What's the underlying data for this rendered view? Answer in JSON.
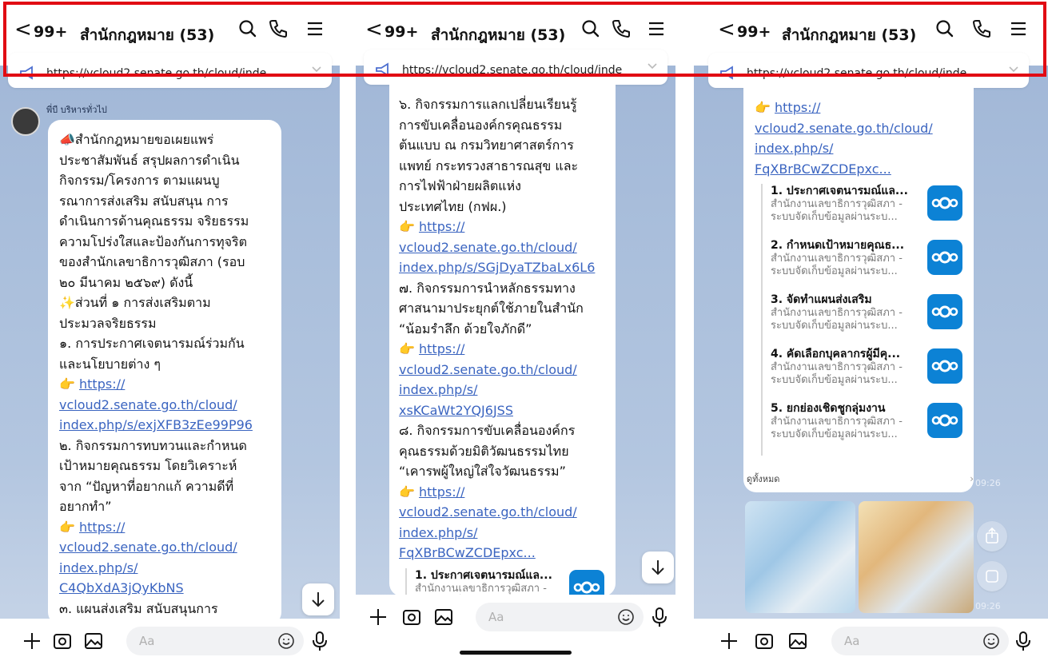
{
  "header": {
    "back_glyph": "<",
    "count": "99+",
    "title": "สำนักกฎหมาย (53)"
  },
  "pinned": {
    "panel1": "https://vcloud2.senate.go.th/cloud/inde...",
    "panel2": "https://vcloud2.senate.go.th/cloud/inde",
    "panel3": "https://vcloud2.senate.go.th/cloud/inde..."
  },
  "sender": "พี่บี บริหารทั่วไป",
  "panel1_lines": [
    {
      "t": "📣สำนักกฎหมายขอเผยแพร่",
      "k": "text"
    },
    {
      "t": "ประชาสัมพันธ์ สรุปผลการดำเนิน",
      "k": "text"
    },
    {
      "t": "กิจกรรม/โครงการ ตามแผนบู",
      "k": "text"
    },
    {
      "t": "รณาการส่งเสริม สนับสนุน การ",
      "k": "text"
    },
    {
      "t": "ดำเนินการด้านคุณธรรม จริยธรรม",
      "k": "text"
    },
    {
      "t": "ความโปร่งใสและป้องกันการทุจริต",
      "k": "text"
    },
    {
      "t": "ของสำนักเลขาธิการวุฒิสภา (รอบ",
      "k": "text"
    },
    {
      "t": "๒๐ มีนาคม ๒๕๖๙) ดังนี้",
      "k": "text"
    },
    {
      "t": "✨ส่วนที่ ๑ การส่งเสริมตาม",
      "k": "text"
    },
    {
      "t": "ประมวลจริยธรรม",
      "k": "text"
    },
    {
      "t": "๑. การประกาศเจตนารมณ์ร่วมกัน",
      "k": "text"
    },
    {
      "t": "และนโยบายต่าง ๆ",
      "k": "text"
    },
    {
      "t": "https://",
      "k": "ptr"
    },
    {
      "t": "vcloud2.senate.go.th/cloud/",
      "k": "link"
    },
    {
      "t": "index.php/s/exjXFB3zEe99P96",
      "k": "link"
    },
    {
      "t": "๒. กิจกรรมการทบทวนและกำหนด",
      "k": "text"
    },
    {
      "t": "เป้าหมายคุณธรรม โดยวิเคราะห์",
      "k": "text"
    },
    {
      "t": "จาก “ปัญหาที่อยากแก้ ความดีที่",
      "k": "text"
    },
    {
      "t": "อยากทำ”",
      "k": "text"
    },
    {
      "t": "https://",
      "k": "ptr"
    },
    {
      "t": "vcloud2.senate.go.th/cloud/",
      "k": "link"
    },
    {
      "t": "index.php/s/",
      "k": "link"
    },
    {
      "t": "C4QbXdA3jQyKbNS",
      "k": "link"
    },
    {
      "t": "๓. แผนส่งเสริม สนับสนุนการ",
      "k": "text"
    }
  ],
  "panel2_lines": [
    {
      "t": "๖. กิจกรรมการแลกเปลี่ยนเรียนรู้",
      "k": "text"
    },
    {
      "t": "การขับเคลื่อนองค์กรคุณธรรม",
      "k": "text"
    },
    {
      "t": "ต้นแบบ ณ กรมวิทยาศาสตร์การ",
      "k": "text"
    },
    {
      "t": "แพทย์ กระทรวงสาธารณสุข และ",
      "k": "text"
    },
    {
      "t": "การไฟฟ้าฝ่ายผลิตแห่ง",
      "k": "text"
    },
    {
      "t": "ประเทศไทย (กฟผ.)",
      "k": "text"
    },
    {
      "t": "https://",
      "k": "ptr"
    },
    {
      "t": "vcloud2.senate.go.th/cloud/",
      "k": "link"
    },
    {
      "t": "index.php/s/SGjDyaTZbaLx6L6",
      "k": "link"
    },
    {
      "t": "๗. กิจกรรมการนำหลักธรรมทาง",
      "k": "text"
    },
    {
      "t": "ศาสนามาประยุกต์ใช้ภายในสำนัก",
      "k": "text"
    },
    {
      "t": "“น้อมรำลึก ด้วยใจภักดี”",
      "k": "text"
    },
    {
      "t": "https://",
      "k": "ptr"
    },
    {
      "t": "vcloud2.senate.go.th/cloud/",
      "k": "link"
    },
    {
      "t": "index.php/s/",
      "k": "link"
    },
    {
      "t": "xsKCaWt2YQJ6JSS",
      "k": "link"
    },
    {
      "t": "๘. กิจกรรมการขับเคลื่อนองค์กร",
      "k": "text"
    },
    {
      "t": "คุณธรรมด้วยมิติวัฒนธรรมไทย",
      "k": "text"
    },
    {
      "t": "“เคารพผู้ใหญ่ใส่ใจวัฒนธรรม”",
      "k": "text"
    },
    {
      "t": "https://",
      "k": "ptr"
    },
    {
      "t": "vcloud2.senate.go.th/cloud/",
      "k": "link"
    },
    {
      "t": "index.php/s/",
      "k": "link"
    },
    {
      "t": "FqXBrBCwZCDEpxc...",
      "k": "link"
    }
  ],
  "panel3_lines": [
    {
      "t": "https://",
      "k": "ptr"
    },
    {
      "t": "vcloud2.senate.go.th/cloud/",
      "k": "link"
    },
    {
      "t": "index.php/s/",
      "k": "link"
    },
    {
      "t": "FqXBrBCwZCDEpxc...",
      "k": "link"
    }
  ],
  "card_sub1": "สำนักงานเลขาธิการวุฒิสภา -",
  "card_sub2": "ระบบจัดเก็บข้อมูลผ่านระบ...",
  "panel2_card_title": "1. ประกาศเจตนารมณ์แล...",
  "panel3_cards": [
    {
      "title": "1. ประกาศเจตนารมณ์แล..."
    },
    {
      "title": "2. กำหนดเป้าหมายคุณธ..."
    },
    {
      "title": "3. จัดทำแผนส่งเสริม"
    },
    {
      "title": "4. คัดเลือกบุคลากรผู้มีคุ..."
    },
    {
      "title": "5. ยกย่องเชิดชูกลุ่มงาน"
    }
  ],
  "see_all": "ดูทั้งหมด",
  "time1": "09:26",
  "time2": "09:26",
  "input_placeholder": "Aa",
  "colors": {
    "accent_link": "#3a64c0",
    "nextcloud_blue": "#0c82d5",
    "highlight": "#e10b13"
  }
}
